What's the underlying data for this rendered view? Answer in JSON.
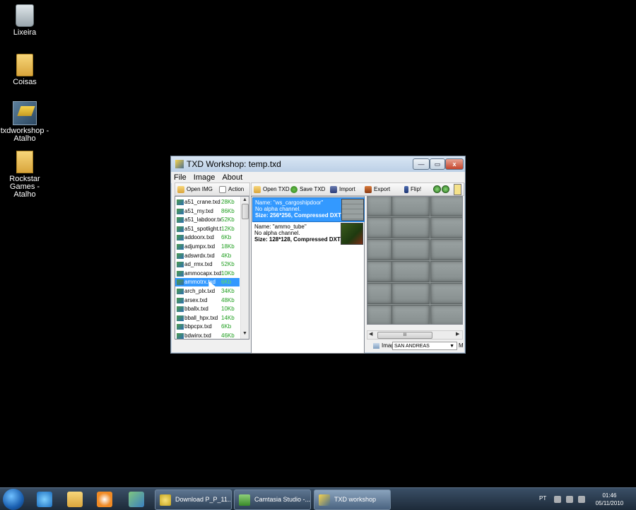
{
  "desktop": {
    "icons": [
      {
        "label": "Lixeira",
        "icon": "recycle-bin-icon"
      },
      {
        "label": "Coisas",
        "icon": "folder-icon"
      },
      {
        "label": "txdworkshop - Atalho",
        "icon": "shortcut-icon"
      },
      {
        "label": "Rockstar Games - Atalho",
        "icon": "folder-shortcut-icon"
      }
    ]
  },
  "window": {
    "title": "TXD Workshop: temp.txd",
    "controls": {
      "minimize": "—",
      "maximize": "▭",
      "close": "x"
    },
    "menu": [
      "File",
      "Image",
      "About"
    ],
    "left_toolbar": {
      "open_img": "Open IMG",
      "action": "Action"
    },
    "right_toolbar": {
      "open_txd": "Open TXD",
      "save_txd": "Save TXD",
      "import": "Import",
      "export": "Export",
      "flip": "Flip!"
    },
    "files": [
      {
        "name": "a51_crane.txd",
        "size": "28Kb"
      },
      {
        "name": "a51_my.txd",
        "size": "86Kb"
      },
      {
        "name": "a51_labdoor.txd",
        "size": "52Kb"
      },
      {
        "name": "a51_spotlight.txd",
        "size": "12Kb"
      },
      {
        "name": "addoorx.txd",
        "size": "6Kb"
      },
      {
        "name": "adjumpx.txd",
        "size": "18Kb"
      },
      {
        "name": "adswrdx.txd",
        "size": "4Kb"
      },
      {
        "name": "ad_rmx.txd",
        "size": "52Kb"
      },
      {
        "name": "ammocapx.txd",
        "size": "10Kb"
      },
      {
        "name": "ammotrx.txd",
        "size": "6Kb"
      },
      {
        "name": "arch_plx.txd",
        "size": "34Kb"
      },
      {
        "name": "arsex.txd",
        "size": "48Kb"
      },
      {
        "name": "bballx.txd",
        "size": "10Kb"
      },
      {
        "name": "bball_hpx.txd",
        "size": "14Kb"
      },
      {
        "name": "bbpcpx.txd",
        "size": "6Kb"
      },
      {
        "name": "bdwinx.txd",
        "size": "46Kb"
      }
    ],
    "selected_file": "ammotrx.txd",
    "textures": [
      {
        "name": "Name: \"ws_cargoshipdoor\"",
        "alpha": "No alpha channel.",
        "size": "Size: 256*256, Compressed DXT1"
      },
      {
        "name": "Name: \"ammo_tube\"",
        "alpha": "No alpha channel.",
        "size": "Size: 128*128, Compressed DXT1"
      }
    ],
    "preview_scroll_label": "III",
    "status": {
      "image_label": "Imag",
      "game": "SAN ANDREAS",
      "extra": "M"
    }
  },
  "taskbar": {
    "tasks": [
      {
        "label": "Download P_P_11..."
      },
      {
        "label": "Camtasia Studio -..."
      },
      {
        "label": "TXD workshop"
      }
    ],
    "language": "PT",
    "time": "01:46",
    "date": "05/11/2010"
  },
  "colors": {
    "selection": "#3399ff",
    "size_text": "#1e9e1e",
    "desktop": "#000000"
  }
}
